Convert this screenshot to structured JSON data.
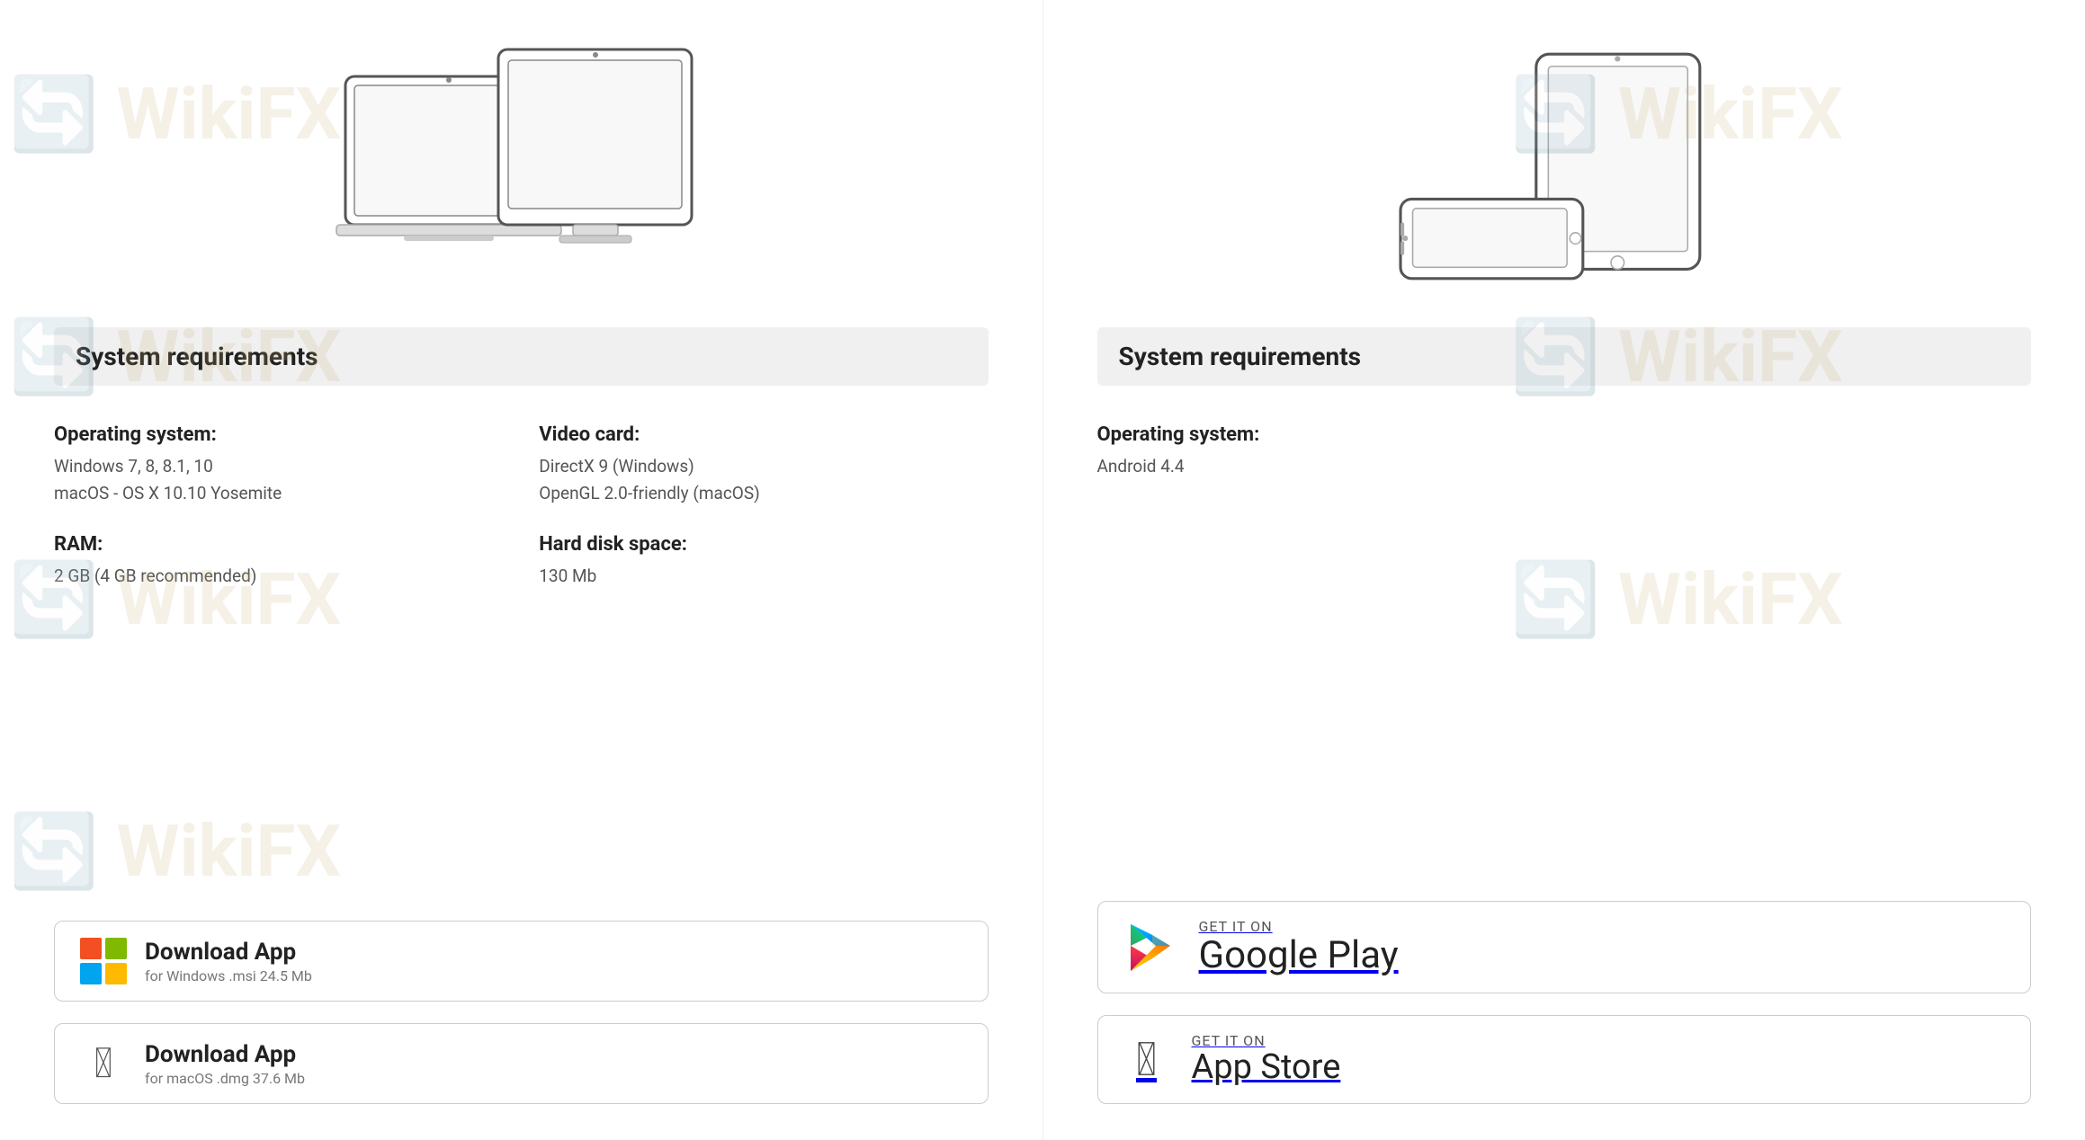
{
  "left_panel": {
    "sys_req_title": "System requirements",
    "os_label": "Operating system:",
    "os_values": [
      "Windows 7, 8, 8.1, 10",
      "macOS - OS X 10.10 Yosemite"
    ],
    "ram_label": "RAM:",
    "ram_value": "2 GB (4 GB recommended)",
    "video_label": "Video card:",
    "video_values": [
      "DirectX 9 (Windows)",
      "OpenGL 2.0-friendly (macOS)"
    ],
    "disk_label": "Hard disk space:",
    "disk_value": "130 Mb",
    "btn_windows_title": "Download App",
    "btn_windows_subtitle": "for Windows .msi 24.5 Mb",
    "btn_mac_title": "Download App",
    "btn_mac_subtitle": "for macOS .dmg 37.6 Mb"
  },
  "right_panel": {
    "sys_req_title": "System requirements",
    "os_label": "Operating system:",
    "os_value": "Android 4.4",
    "btn_google_get": "GET IT ON",
    "btn_google_store": "Google Play",
    "btn_apple_get": "GET IT ON",
    "btn_apple_store": "App Store"
  },
  "watermark_text": "WikiFX"
}
